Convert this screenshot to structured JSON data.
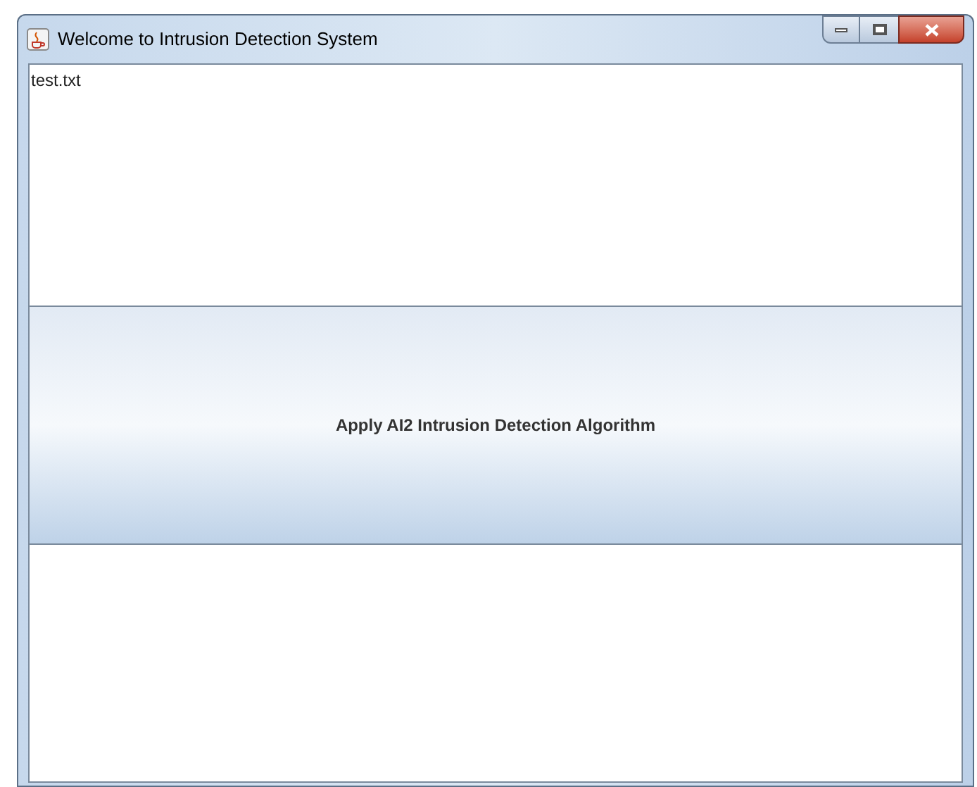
{
  "window": {
    "title": "Welcome to Intrusion Detection System"
  },
  "text_area": {
    "value": "test.txt"
  },
  "button": {
    "label": "Apply AI2 Intrusion Detection Algorithm"
  }
}
